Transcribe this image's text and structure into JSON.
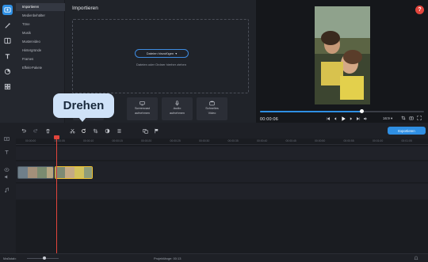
{
  "left_toolbar": {
    "tools": [
      {
        "icon": "import-icon",
        "active": true
      },
      {
        "icon": "magic-wand-icon",
        "active": false
      },
      {
        "icon": "transitions-icon",
        "active": false
      },
      {
        "icon": "titles-icon",
        "active": false
      },
      {
        "icon": "stickers-icon",
        "active": false
      },
      {
        "icon": "more-tools-icon",
        "active": false
      }
    ]
  },
  "sidebar": {
    "items": [
      {
        "label": "Importieren"
      },
      {
        "label": "Medienbehälter"
      },
      {
        "label": "Töne"
      },
      {
        "label": "Musik"
      },
      {
        "label": "Mustervideo"
      },
      {
        "label": "Hintergründe"
      },
      {
        "label": "Frames"
      },
      {
        "label": "Effekt-Pakete"
      }
    ]
  },
  "import_panel": {
    "title": "Importieren",
    "add_files_label": "Dateien hinzufügen",
    "drop_hint": "Dateien oder Ordner hierher ziehen",
    "buttons": [
      {
        "label_1": "",
        "label_2": "",
        "icon": "folder-icon"
      },
      {
        "label_1": "Screencast",
        "label_2": "aufnehmen",
        "icon": "screencast-icon"
      },
      {
        "label_1": "Audio",
        "label_2": "aufnehmen",
        "icon": "microphone-icon"
      },
      {
        "label_1": "Schnelles",
        "label_2": "Video",
        "icon": "quick-video-icon"
      }
    ]
  },
  "tooltip": {
    "text": "Drehen"
  },
  "preview": {
    "timecode": "00:00:06",
    "timecode_small": "",
    "aspect": "16:9 ▾",
    "progress": 0.62
  },
  "edit_toolbar": {
    "export_label": "Exportieren"
  },
  "timeline": {
    "ticks": [
      "00:00:00",
      "00:00:05",
      "00:00:10",
      "00:00:15",
      "00:00:20",
      "00:00:25",
      "00:00:30",
      "00:00:35",
      "00:00:40",
      "00:00:45",
      "00:00:50",
      "00:00:55",
      "00:01:00",
      "00:01:05"
    ]
  },
  "status_bar": {
    "scale_label": "Maßstab:",
    "project_length": "Projektlänge: 00:13"
  },
  "colors": {
    "accent": "#2f8fe3",
    "playhead": "#e2453c",
    "selected_clip": "#f0c232"
  }
}
